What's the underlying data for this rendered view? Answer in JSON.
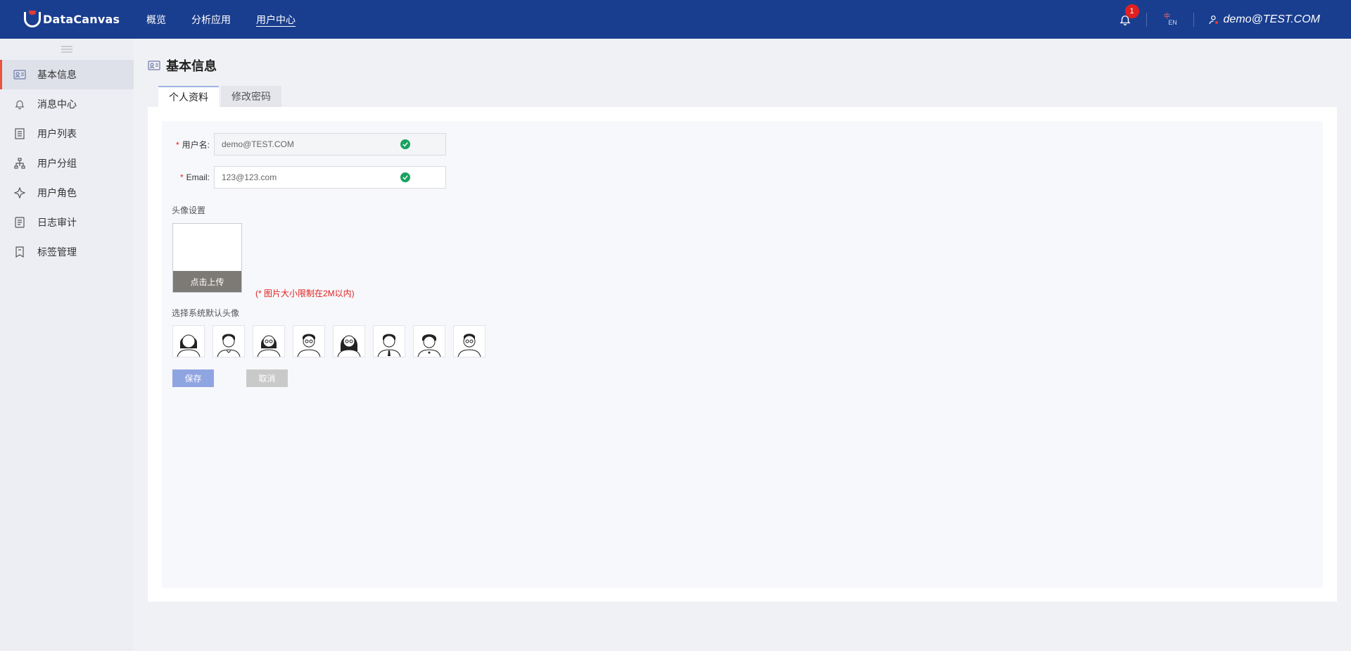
{
  "header": {
    "brand": "DataCanvas",
    "nav": [
      {
        "label": "概览"
      },
      {
        "label": "分析应用"
      },
      {
        "label": "用户中心"
      }
    ],
    "notification_count": "1",
    "lang_zh": "中",
    "lang_en": "EN",
    "user_email": "demo@TEST.COM"
  },
  "sidebar": {
    "items": [
      {
        "label": "基本信息",
        "icon": "id-card-icon"
      },
      {
        "label": "消息中心",
        "icon": "bell-icon"
      },
      {
        "label": "用户列表",
        "icon": "list-icon"
      },
      {
        "label": "用户分组",
        "icon": "org-tree-icon"
      },
      {
        "label": "用户角色",
        "icon": "star-role-icon"
      },
      {
        "label": "日志审计",
        "icon": "log-icon"
      },
      {
        "label": "标签管理",
        "icon": "bookmark-icon"
      }
    ]
  },
  "page": {
    "title": "基本信息",
    "tabs": [
      {
        "label": "个人资料"
      },
      {
        "label": "修改密码"
      }
    ]
  },
  "form": {
    "username_label": "用户名:",
    "username_value": "demo@TEST.COM",
    "email_label": "Email:",
    "email_value": "123@123.com",
    "required_mark": "*",
    "avatar_section": "头像设置",
    "upload_label": "点击上传",
    "upload_hint": "(* 图片大小限制在2M以内)",
    "default_avatar_label": "选择系统默认头像",
    "save_label": "保存",
    "cancel_label": "取消"
  },
  "colors": {
    "topbar": "#1a3e8f",
    "accent_active": "#e8543c",
    "success": "#1aa260",
    "save_button": "#8fa5e2",
    "hint_red": "#e02020"
  }
}
